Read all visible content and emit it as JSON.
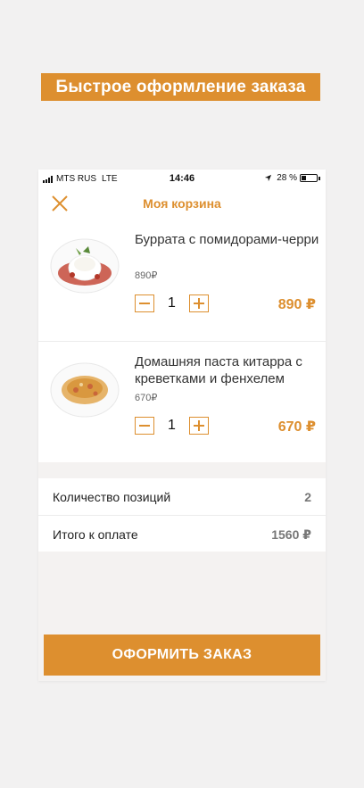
{
  "banner": {
    "text": "Быстрое оформление заказа"
  },
  "status_bar": {
    "carrier": "MTS RUS",
    "network": "LTE",
    "time": "14:46",
    "battery": "28 %",
    "battery_level": 0.28
  },
  "nav": {
    "title": "Моя корзина",
    "close_icon": "close-icon"
  },
  "cart": {
    "items": [
      {
        "name": "Буррата с помидорами-черри",
        "price": "890₽",
        "quantity": "1",
        "total": "890 ₽"
      },
      {
        "name": "Домашняя паста китарра с креветками и фенхелем",
        "price": "670₽",
        "quantity": "1",
        "total": "670 ₽"
      }
    ]
  },
  "summary": {
    "count_label": "Количество позиций",
    "count_value": "2",
    "total_label": "Итого к оплате",
    "total_value": "1560 ₽"
  },
  "checkout": {
    "label": "ОФОРМИТЬ ЗАКАЗ"
  },
  "colors": {
    "accent": "#dd8f2f",
    "background": "#f2f1f1"
  }
}
